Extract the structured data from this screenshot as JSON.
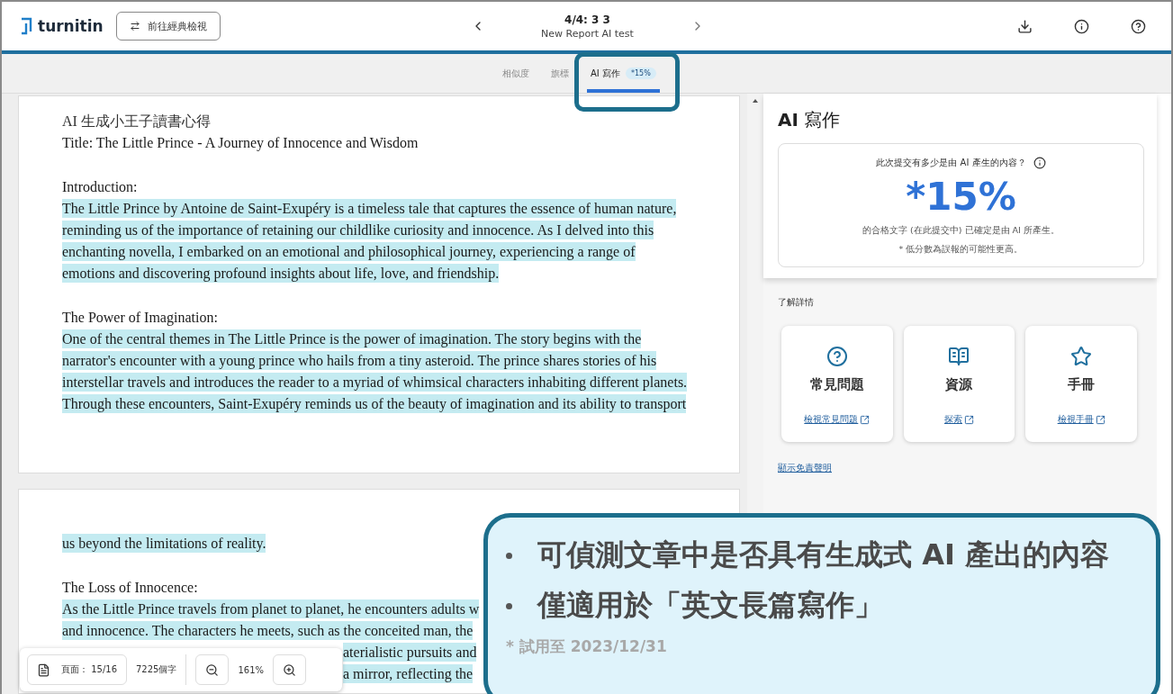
{
  "header": {
    "logo": "turnitin",
    "classic_button": "前往經典檢視",
    "report_position": "4/4: 3 3",
    "report_title": "New Report AI test"
  },
  "tabs": [
    {
      "label": "相似度",
      "selected": false
    },
    {
      "label": "旗標",
      "selected": false
    },
    {
      "label": "AI 寫作",
      "badge": "*15%",
      "selected": true
    }
  ],
  "pages": [
    {
      "lines": [
        {
          "kind": "heading",
          "text": "AI  生成小王子讀書心得",
          "highlighted": false
        },
        {
          "kind": "text",
          "text": "Title: The Little Prince - A Journey of Innocence and Wisdom",
          "highlighted": false
        },
        {
          "kind": "blank"
        },
        {
          "kind": "text",
          "text": "Introduction:",
          "highlighted": false
        },
        {
          "kind": "text",
          "text": "The Little Prince by Antoine de Saint-Exupéry is a timeless tale that captures the essence of human nature,",
          "highlighted": true
        },
        {
          "kind": "text",
          "text": "reminding us of the importance of retaining our childlike curiosity and innocence. As I delved into this",
          "highlighted": true
        },
        {
          "kind": "text",
          "text": "enchanting novella, I embarked on an emotional and philosophical journey, experiencing a range of",
          "highlighted": true
        },
        {
          "kind": "text",
          "text": "emotions and discovering profound insights about life, love, and friendship.",
          "highlighted": true
        },
        {
          "kind": "blank"
        },
        {
          "kind": "text",
          "text": "The Power of Imagination:",
          "highlighted": false
        },
        {
          "kind": "text",
          "text": "One of the central themes in The Little Prince is the power of imagination. The story begins with the",
          "highlighted": true
        },
        {
          "kind": "text",
          "text": "narrator's encounter with a young prince who hails from a tiny asteroid. The prince shares stories of his",
          "highlighted": true
        },
        {
          "kind": "text",
          "text": "interstellar travels and introduces the reader to a myriad of whimsical characters inhabiting different planets.",
          "highlighted": true
        },
        {
          "kind": "text",
          "text": "Through these encounters, Saint-Exupéry reminds us of the beauty of imagination and its ability to transport",
          "highlighted": true
        }
      ]
    },
    {
      "lines": [
        {
          "kind": "text",
          "text": "us beyond the limitations of reality.",
          "highlighted": true
        },
        {
          "kind": "blank"
        },
        {
          "kind": "text",
          "text": "The Loss of Innocence:",
          "highlighted": false
        },
        {
          "kind": "text",
          "text": "As the Little Prince travels from planet to planet, he encounters adults w",
          "highlighted": true
        },
        {
          "kind": "text",
          "text": "and innocence. The characters he meets, such as the conceited man, the",
          "highlighted": true
        },
        {
          "kind": "tail",
          "text": "aterialistic pursuits and",
          "highlighted": true
        },
        {
          "kind": "tail",
          "text": "a mirror, reflecting the",
          "highlighted": true
        }
      ]
    }
  ],
  "ai_panel": {
    "title": "**AI** 寫作",
    "question": "此次提交有多少是由 AI 產生的內容？",
    "score": "*15%",
    "description": "的合格文字 (在此提交中) 已確定是由 AI 所產生。",
    "note": "* 低分數為誤報的可能性更高。"
  },
  "learn_more": {
    "label": "了解詳情",
    "cards": [
      {
        "kind": "help",
        "title": "常見問題",
        "link": "檢視常見問題"
      },
      {
        "kind": "book",
        "title": "資源",
        "link": "探索"
      },
      {
        "kind": "star",
        "title": "手冊",
        "link": "檢視手冊"
      }
    ],
    "disclaimer_link": "顯示免責聲明"
  },
  "toolbar": {
    "page": "頁面： 15/16",
    "words": "7225個字",
    "zoom": "161%"
  },
  "callout": {
    "bullets": [
      "可偵測文章中是否具有生成式 AI 產出的內容",
      "僅適用於「英文長篇寫作」"
    ],
    "footnote": "* 試用至 2023/12/31"
  }
}
